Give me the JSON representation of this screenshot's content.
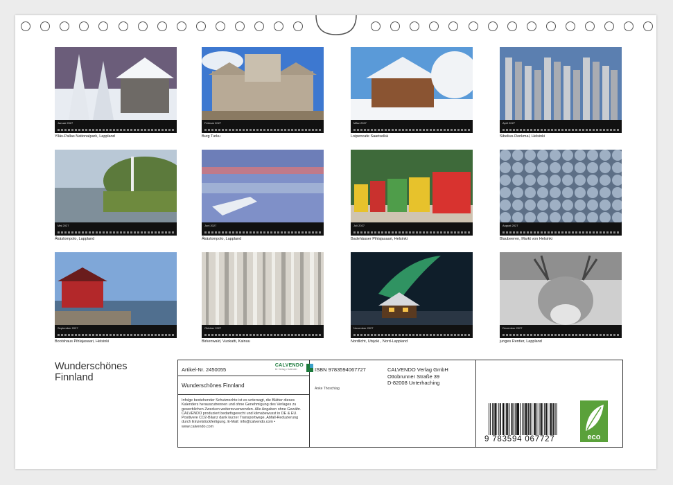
{
  "months": [
    {
      "label": "Januar 2027",
      "caption": "Ylläs-Pallas Nationalpark, Lappland",
      "icon": "snowy-log-cabin-photo"
    },
    {
      "label": "Februar 2027",
      "caption": "Burg Turku",
      "icon": "castle-photo"
    },
    {
      "label": "März 2027",
      "caption": "Loipencafe Saariselkä",
      "icon": "winter-wooden-house-photo"
    },
    {
      "label": "April 2027",
      "caption": "Sibelius-Denkmal, Helsinki",
      "icon": "steel-pipes-monument-photo"
    },
    {
      "label": "Mai 2027",
      "caption": "Äkäslompolo, Lappland",
      "icon": "lake-shore-photo"
    },
    {
      "label": "Juni 2027",
      "caption": "Äkäslompolo, Lappland",
      "icon": "boat-on-lake-photo"
    },
    {
      "label": "Juli 2027",
      "caption": "Badehäuser Pihlajasaari, Helsinki",
      "icon": "beach-huts-photo"
    },
    {
      "label": "August 2027",
      "caption": "Blaubeeren, Markt von Helsinki",
      "icon": "blueberries-photo"
    },
    {
      "label": "September 2027",
      "caption": "Bootshaus Pihlajasaari, Helsinki",
      "icon": "red-boathouse-photo"
    },
    {
      "label": "Oktober 2027",
      "caption": "Birkenwald, Vuokatti, Kainuu",
      "icon": "birch-forest-photo"
    },
    {
      "label": "November 2027",
      "caption": "Nordlicht, Utsjoki , Nord-Lappland",
      "icon": "northern-lights-photo"
    },
    {
      "label": "Dezember 2027",
      "caption": "junges Rentier, Lappland",
      "icon": "reindeer-photo"
    }
  ],
  "title": "Wunderschönes Finnland",
  "info": {
    "article": "Artikel-Nr. 2450055",
    "short_title": "Wunderschönes Finnland",
    "logo": "CALVENDO",
    "logo_sub": "ihr Verlag • Kalender",
    "legal": "Infolge bestehender Schutzrechte ist es untersagt, die Blätter dieses Kalenders herauszutrennen und ohne Genehmigung des Verlages zu gewerblichen Zwecken weiterzuverwenden. Alle Angaben ohne Gewähr. CALVENDO produziert bedarfsgerecht und klimabewusst in DE & EU. Positivere CO2-Bilanz dank kurzer Transportwege, Abfall-Reduzierung durch Einzelstückfertigung. E-Mail: info@calvendo.com • www.calvendo.com",
    "isbn": "ISBN 9783594067727",
    "publisher": [
      "CALVENDO Verlag GmbH",
      "Ottobrunner Straße 39",
      "D-82008 Unterhaching"
    ],
    "author": "Anke Thoschlag",
    "barcode_number": "9 783594 067727",
    "eco_label": "eco"
  },
  "colors": {
    "strip": "#111111",
    "eco_green": "#5aa13a",
    "calvendo_green": "#1c7a3c"
  }
}
